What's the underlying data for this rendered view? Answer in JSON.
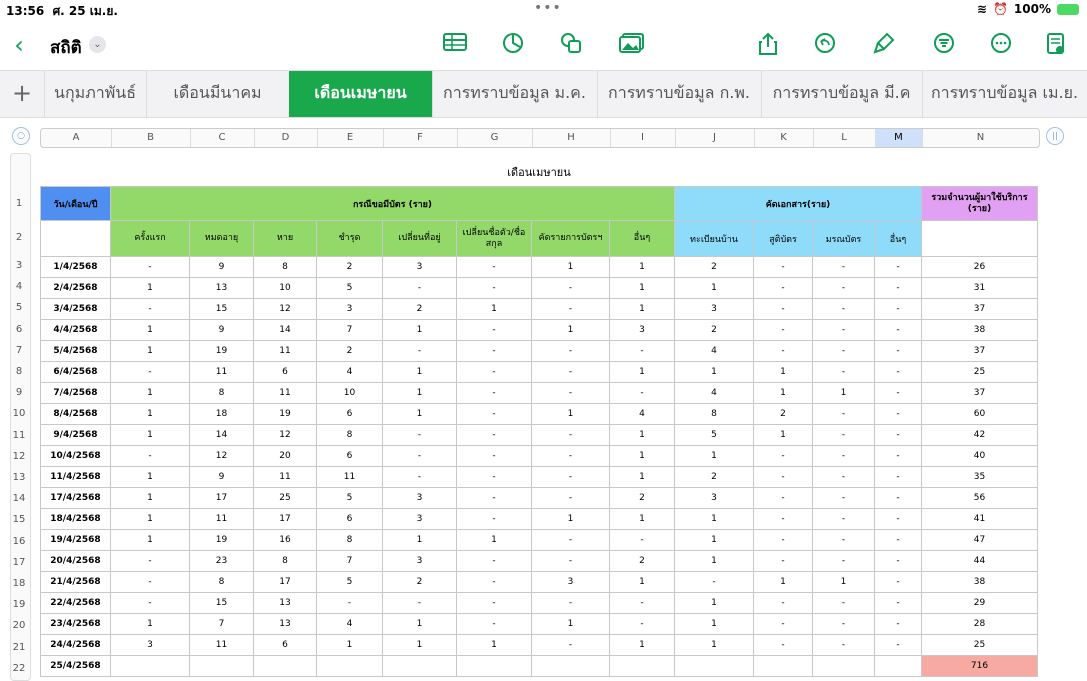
{
  "status": {
    "time": "13:56",
    "date": "ศ. 25 เม.ย.",
    "battery": "100%"
  },
  "toolbar": {
    "title": "สถิติ"
  },
  "tabs": [
    {
      "label": "นกุมภาพันธ์",
      "active": false
    },
    {
      "label": "เดือนมีนาคม",
      "active": false
    },
    {
      "label": "เดือนเมษายน",
      "active": true
    },
    {
      "label": "การทราบข้อมูล ม.ค.",
      "active": false
    },
    {
      "label": "การทราบข้อมูล ก.พ.",
      "active": false
    },
    {
      "label": "การทราบข้อมูล มี.ค",
      "active": false
    },
    {
      "label": "การทราบข้อมูล เม.ย.",
      "active": false
    }
  ],
  "columns": [
    "A",
    "B",
    "C",
    "D",
    "E",
    "F",
    "G",
    "H",
    "I",
    "J",
    "K",
    "L",
    "M",
    "N"
  ],
  "selected_column": "M",
  "sheet": {
    "title": "เดือนเมษายน",
    "date_header": "วัน/เดือน/ปี",
    "group_card": "กรณีขอมีบัตร (ราย)",
    "group_docs": "คัดเอกสาร(ราย)",
    "group_total": "รวมจำนวนผู้มาใช้บริการ (ราย)",
    "subheaders": [
      "ครั้งแรก",
      "หมดอายุ",
      "หาย",
      "ชำรุด",
      "เปลี่ยนที่อยู่",
      "เปลี่ยนชื่อตัว/ชื่อสกุล",
      "คัดรายการบัตรฯ",
      "อื่นๆ",
      "ทะเบียนบ้าน",
      "สูติบัตร",
      "มรณบัตร",
      "อื่นๆ"
    ],
    "rows": [
      {
        "n": "3",
        "date": "1/4/2568",
        "v": [
          "-",
          "9",
          "8",
          "2",
          "3",
          "-",
          "1",
          "1",
          "2",
          "-",
          "-",
          "-"
        ],
        "total": "26"
      },
      {
        "n": "4",
        "date": "2/4/2568",
        "v": [
          "1",
          "13",
          "10",
          "5",
          "-",
          "-",
          "-",
          "1",
          "1",
          "-",
          "-",
          "-"
        ],
        "total": "31"
      },
      {
        "n": "5",
        "date": "3/4/2568",
        "v": [
          "-",
          "15",
          "12",
          "3",
          "2",
          "1",
          "-",
          "1",
          "3",
          "-",
          "-",
          "-"
        ],
        "total": "37"
      },
      {
        "n": "6",
        "date": "4/4/2568",
        "v": [
          "1",
          "9",
          "14",
          "7",
          "1",
          "-",
          "1",
          "3",
          "2",
          "-",
          "-",
          "-"
        ],
        "total": "38"
      },
      {
        "n": "7",
        "date": "5/4/2568",
        "v": [
          "1",
          "19",
          "11",
          "2",
          "-",
          "-",
          "-",
          "-",
          "4",
          "-",
          "-",
          "-"
        ],
        "total": "37"
      },
      {
        "n": "8",
        "date": "6/4/2568",
        "v": [
          "-",
          "11",
          "6",
          "4",
          "1",
          "-",
          "-",
          "1",
          "1",
          "1",
          "-",
          "-"
        ],
        "total": "25"
      },
      {
        "n": "9",
        "date": "7/4/2568",
        "v": [
          "1",
          "8",
          "11",
          "10",
          "1",
          "-",
          "-",
          "-",
          "4",
          "1",
          "1",
          "-"
        ],
        "total": "37"
      },
      {
        "n": "10",
        "date": "8/4/2568",
        "v": [
          "1",
          "18",
          "19",
          "6",
          "1",
          "-",
          "1",
          "4",
          "8",
          "2",
          "-",
          "-"
        ],
        "total": "60"
      },
      {
        "n": "11",
        "date": "9/4/2568",
        "v": [
          "1",
          "14",
          "12",
          "8",
          "-",
          "-",
          "-",
          "1",
          "5",
          "1",
          "-",
          "-"
        ],
        "total": "42"
      },
      {
        "n": "12",
        "date": "10/4/2568",
        "v": [
          "-",
          "12",
          "20",
          "6",
          "-",
          "-",
          "-",
          "1",
          "1",
          "-",
          "-",
          "-"
        ],
        "total": "40"
      },
      {
        "n": "13",
        "date": "11/4/2568",
        "v": [
          "1",
          "9",
          "11",
          "11",
          "-",
          "-",
          "-",
          "1",
          "2",
          "-",
          "-",
          "-"
        ],
        "total": "35"
      },
      {
        "n": "14",
        "date": "17/4/2568",
        "v": [
          "1",
          "17",
          "25",
          "5",
          "3",
          "-",
          "-",
          "2",
          "3",
          "-",
          "-",
          "-"
        ],
        "total": "56"
      },
      {
        "n": "15",
        "date": "18/4/2568",
        "v": [
          "1",
          "11",
          "17",
          "6",
          "3",
          "-",
          "1",
          "1",
          "1",
          "-",
          "-",
          "-"
        ],
        "total": "41"
      },
      {
        "n": "16",
        "date": "19/4/2568",
        "v": [
          "1",
          "19",
          "16",
          "8",
          "1",
          "1",
          "-",
          "-",
          "1",
          "-",
          "-",
          "-"
        ],
        "total": "47"
      },
      {
        "n": "17",
        "date": "20/4/2568",
        "v": [
          "-",
          "23",
          "8",
          "7",
          "3",
          "-",
          "-",
          "2",
          "1",
          "-",
          "-",
          "-"
        ],
        "total": "44"
      },
      {
        "n": "18",
        "date": "21/4/2568",
        "v": [
          "-",
          "8",
          "17",
          "5",
          "2",
          "-",
          "3",
          "1",
          "-",
          "1",
          "1",
          "-"
        ],
        "total": "38"
      },
      {
        "n": "19",
        "date": "22/4/2568",
        "v": [
          "-",
          "15",
          "13",
          "-",
          "-",
          "-",
          "-",
          "-",
          "1",
          "-",
          "-",
          "-"
        ],
        "total": "29"
      },
      {
        "n": "20",
        "date": "23/4/2568",
        "v": [
          "1",
          "7",
          "13",
          "4",
          "1",
          "-",
          "1",
          "-",
          "1",
          "-",
          "-",
          "-"
        ],
        "total": "28"
      },
      {
        "n": "21",
        "date": "24/4/2568",
        "v": [
          "3",
          "11",
          "6",
          "1",
          "1",
          "1",
          "-",
          "1",
          "1",
          "-",
          "-",
          "-"
        ],
        "total": "25"
      },
      {
        "n": "22",
        "date": "25/4/2568",
        "v": [
          "",
          "",
          "",
          "",
          "",
          "",
          "",
          "",
          "",
          "",
          "",
          ""
        ],
        "total": "716"
      }
    ]
  }
}
